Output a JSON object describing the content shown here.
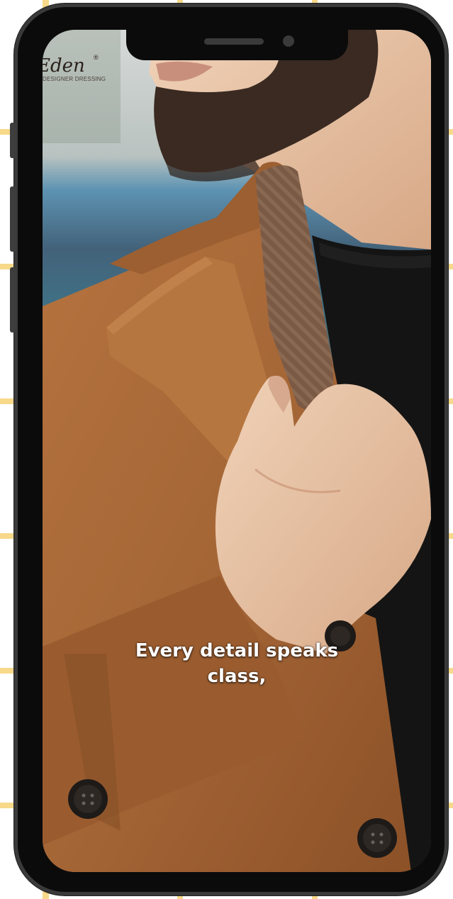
{
  "brand": {
    "logo_text": "Eden",
    "logo_tagline": "DESIGNER DRESSING",
    "registered_mark": "®"
  },
  "video": {
    "caption_line1": "Every detail speaks",
    "caption_line2": "class,"
  },
  "colors": {
    "grid_line": "#f7d98a",
    "phone_frame": "#0b0b0b",
    "coat": "#a8683a",
    "lapel_pattern": "#7a5a45",
    "sweater": "#141414",
    "skin": "#e9c5a9"
  }
}
